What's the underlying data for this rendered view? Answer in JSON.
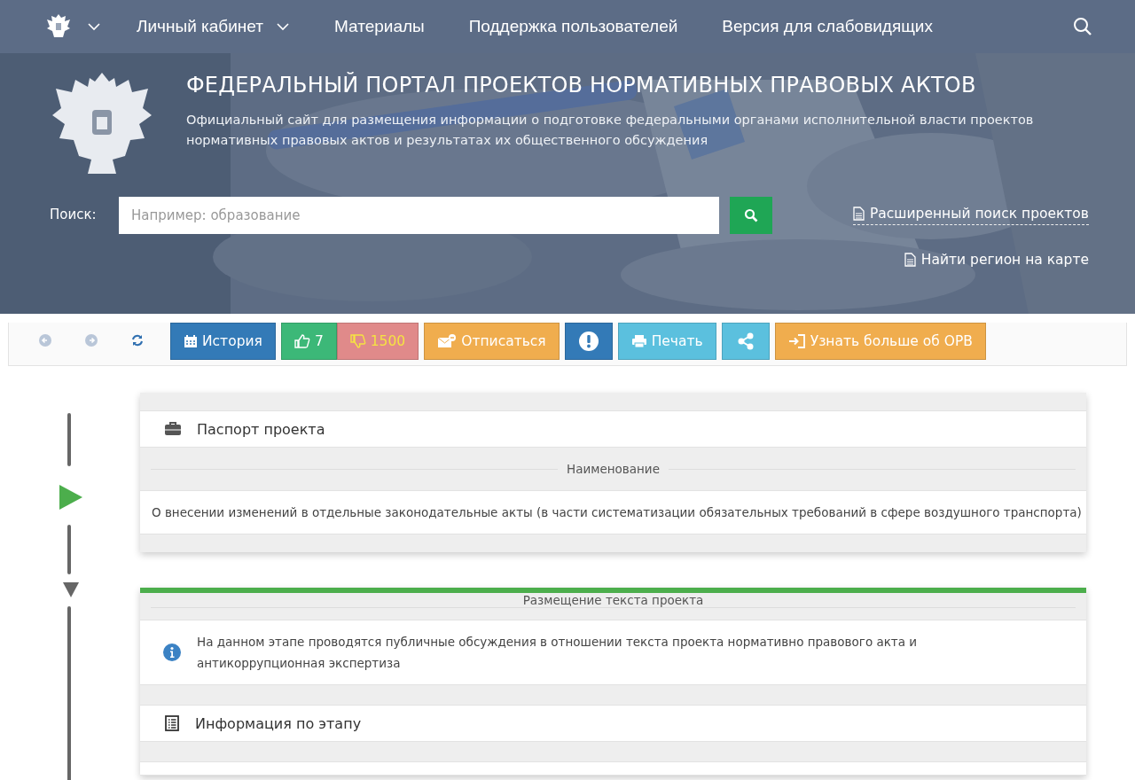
{
  "nav": {
    "items": [
      {
        "kind": "emblem-menu"
      },
      {
        "kind": "dropdown",
        "label": "Личный кабинет"
      },
      {
        "kind": "link",
        "label": "Материалы"
      },
      {
        "kind": "link",
        "label": "Поддержка пользователей"
      },
      {
        "kind": "link",
        "label": "Версия для слабовидящих"
      },
      {
        "kind": "search"
      }
    ]
  },
  "hero": {
    "title": "ФЕДЕРАЛЬНЫЙ ПОРТАЛ ПРОЕКТОВ НОРМАТИВНЫХ ПРАВОВЫХ АКТОВ",
    "subtitle": "Официальный сайт для размещения информации о подготовке федеральными органами исполнительной власти проектов нормативных правовых актов и результатах их общественного обсуждения",
    "search_label": "Поиск:",
    "search_placeholder": "Например: образование",
    "links": [
      "Расширенный поиск проектов",
      "Найти регион на карте"
    ]
  },
  "toolbar": [
    {
      "kind": "back"
    },
    {
      "kind": "forward"
    },
    {
      "kind": "refresh"
    },
    {
      "kind": "history",
      "label": "История",
      "color": "#337ab7"
    },
    {
      "kind": "like",
      "label": "7",
      "color": "#3cb878"
    },
    {
      "kind": "dislike",
      "label": "1500",
      "color": "#e08a8a"
    },
    {
      "kind": "unsubscribe",
      "label": "Отписаться",
      "color": "#f0ad4e"
    },
    {
      "kind": "alert",
      "color": "#337ab7"
    },
    {
      "kind": "print",
      "label": "Печать",
      "color": "#5bc0de"
    },
    {
      "kind": "share",
      "color": "#5bc0de"
    },
    {
      "kind": "login",
      "label": "Узнать больше об ОРВ",
      "color": "#f0ad4e"
    }
  ],
  "passport": {
    "title": "Паспорт проекта",
    "section": "Наименование",
    "text": "О внесении изменений в отдельные законодательные акты (в части систематизации обязательных требований в сфере воздушного транспорта)"
  },
  "stage": {
    "title": "Размещение текста проекта",
    "info": "На данном этапе проводятся публичные обсуждения в отношении текста проекта нормативно правового акта и антикоррупционная экспертиза",
    "section": "Информация по этапу"
  }
}
